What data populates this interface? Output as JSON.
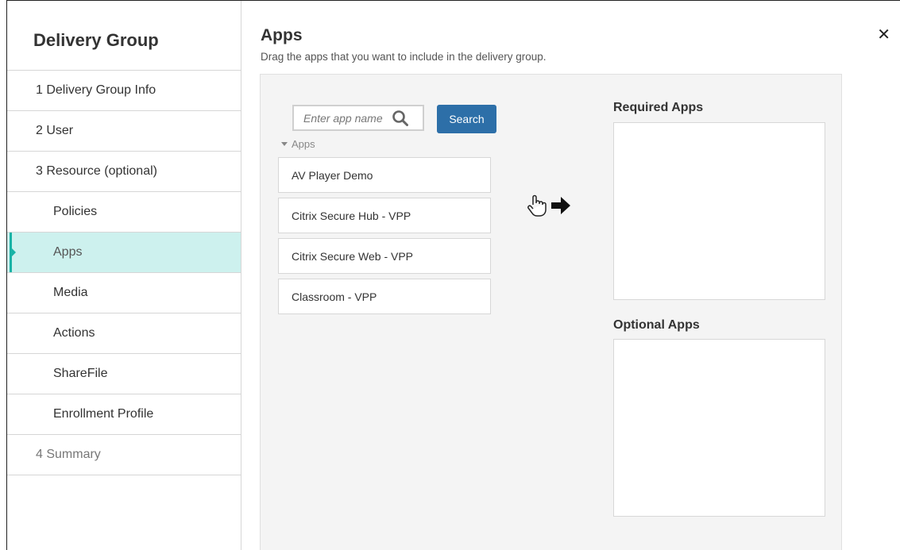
{
  "sidebar": {
    "title": "Delivery Group",
    "items": [
      {
        "label": "1  Delivery Group Info"
      },
      {
        "label": "2  User"
      },
      {
        "label": "3  Resource (optional)"
      },
      {
        "label": "Policies"
      },
      {
        "label": "Apps"
      },
      {
        "label": "Media"
      },
      {
        "label": "Actions"
      },
      {
        "label": "ShareFile"
      },
      {
        "label": "Enrollment Profile"
      },
      {
        "label": "4  Summary"
      }
    ],
    "active_item": "Apps",
    "accent_color": "#19b3a6",
    "active_bg": "#cdf1ee"
  },
  "header": {
    "title": "Apps",
    "subtitle": "Drag the apps that you want to include in the delivery group.",
    "close_icon": "close-icon"
  },
  "search": {
    "placeholder": "Enter app name",
    "value": "",
    "button_label": "Search",
    "button_color": "#2d6fa8"
  },
  "apps": {
    "group_label": "Apps",
    "items": [
      {
        "label": "AV Player Demo"
      },
      {
        "label": "Citrix Secure Hub - VPP"
      },
      {
        "label": "Citrix Secure Web - VPP"
      },
      {
        "label": "Classroom - VPP"
      }
    ]
  },
  "drop_targets": {
    "required_label": "Required Apps",
    "optional_label": "Optional Apps"
  },
  "drag_hint_icons": [
    "hand-pointer-icon",
    "arrow-right-icon"
  ]
}
